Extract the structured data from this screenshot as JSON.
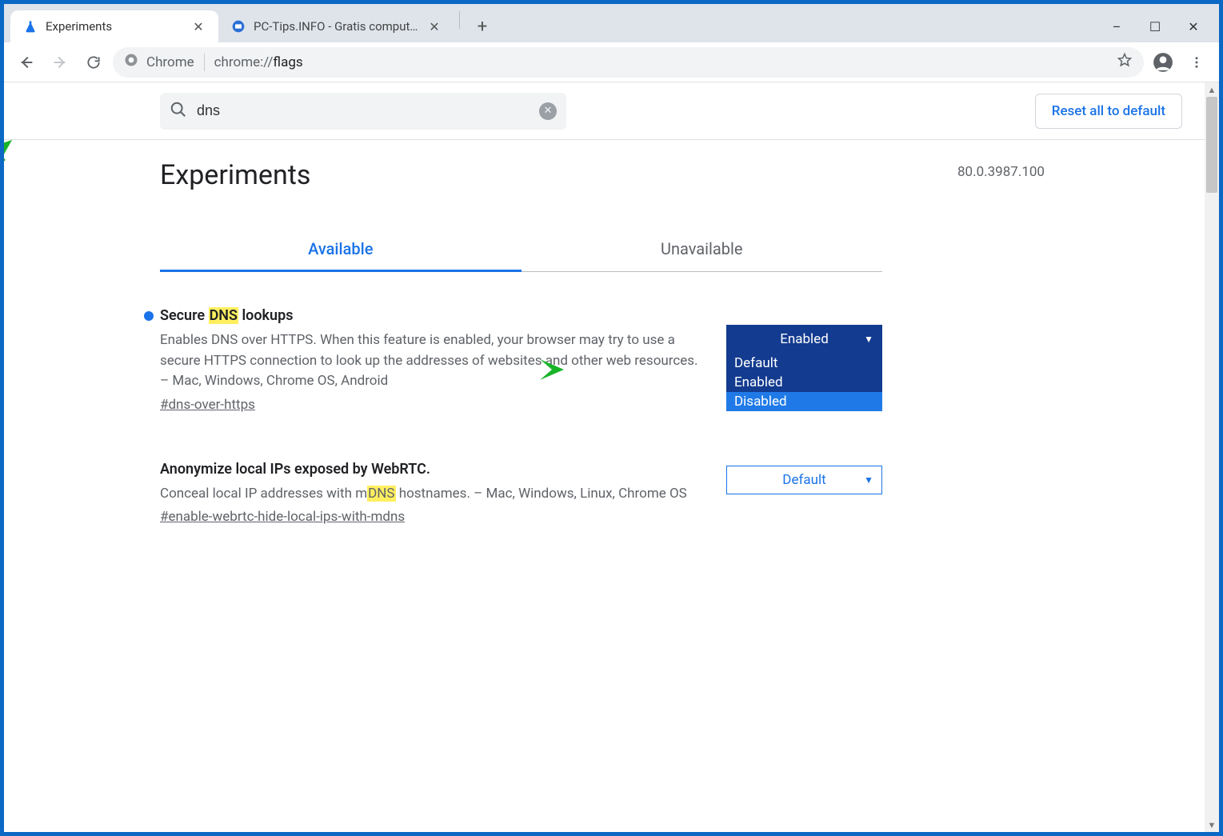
{
  "window": {
    "minimize": "–",
    "maximize": "☐",
    "close": "✕"
  },
  "tabs": [
    {
      "title": "Experiments",
      "active": true
    },
    {
      "title": "PC-Tips.INFO - Gratis computer t",
      "active": false
    }
  ],
  "omnibox": {
    "chip_label": "Chrome",
    "path_prefix": "chrome://",
    "path_strong": "flags"
  },
  "search": {
    "value": "dns"
  },
  "reset_label": "Reset all to default",
  "heading": "Experiments",
  "version": "80.0.3987.100",
  "page_tabs": {
    "available": "Available",
    "unavailable": "Unavailable"
  },
  "flags": [
    {
      "title_pre": "Secure ",
      "title_hl": "DNS",
      "title_post": " lookups",
      "dot": true,
      "desc_pre": "Enables DNS over HTTPS. When this feature is enabled, your browser may try to use a secure HTTPS connection to look up the addresses of websites and other web resources. – Mac, Windows, Chrome OS, Android",
      "hash": "#dns-over-https",
      "select_value": "Enabled",
      "select_style": "filled",
      "options": [
        "Default",
        "Enabled",
        "Disabled"
      ],
      "open": true
    },
    {
      "title_pre": "Anonymize local IPs exposed by WebRTC.",
      "title_hl": "",
      "title_post": "",
      "dot": false,
      "desc_pre": "Conceal local IP addresses with m",
      "desc_hl": "DNS",
      "desc_post": " hostnames. – Mac, Windows, Linux, Chrome OS",
      "hash": "#enable-webrtc-hide-local-ips-with-mdns",
      "select_value": "Default",
      "select_style": "outline",
      "open": false
    }
  ]
}
